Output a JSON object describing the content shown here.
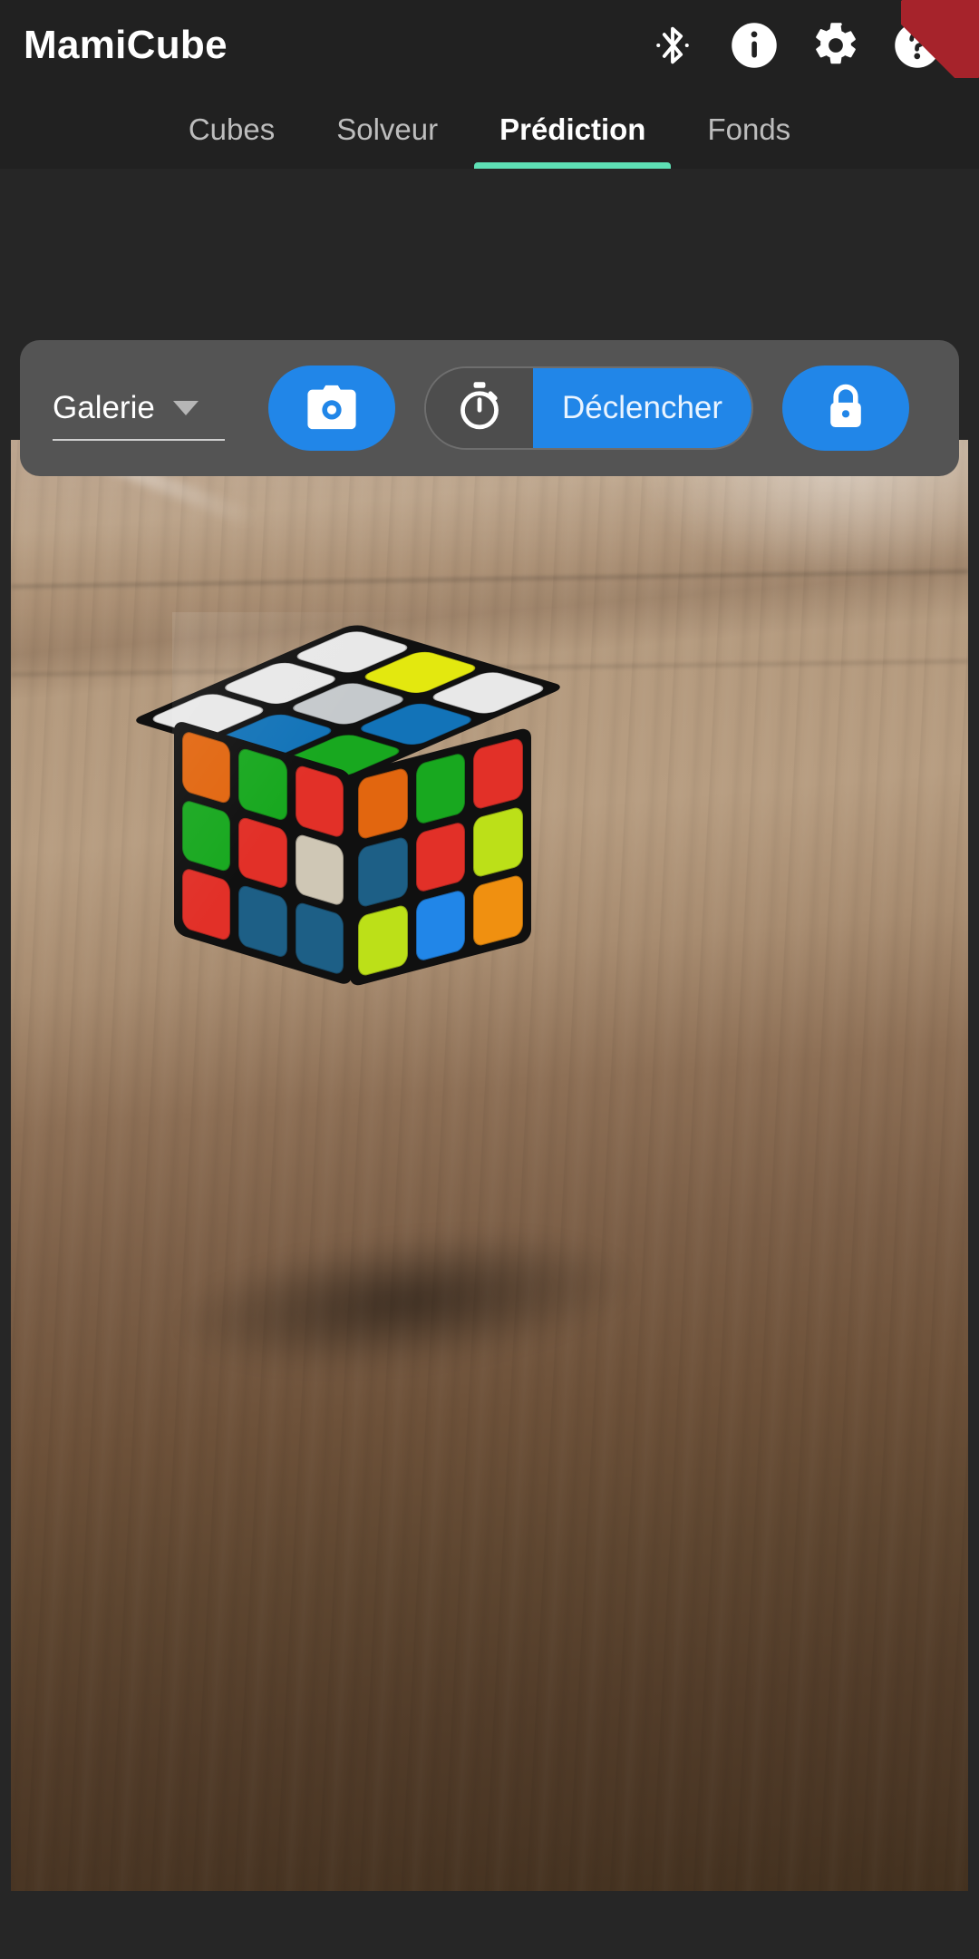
{
  "app": {
    "title": "MamiCube",
    "accent_blue": "#2186e8",
    "tab_indicator": "#5ee0b5",
    "appbar_bg": "#212121",
    "panel_bg": "#545454",
    "ribbon_color": "#a6232b"
  },
  "appbar": {
    "icons": [
      {
        "name": "bluetooth-icon",
        "label": "Bluetooth"
      },
      {
        "name": "info-icon",
        "label": "Informations"
      },
      {
        "name": "settings-gear-icon",
        "label": "Paramètres"
      },
      {
        "name": "help-icon",
        "label": "Aide"
      }
    ]
  },
  "tabs": [
    {
      "label": "Cubes",
      "active": false
    },
    {
      "label": "Solveur",
      "active": false
    },
    {
      "label": "Prédiction",
      "active": true
    },
    {
      "label": "Fonds",
      "active": false
    }
  ],
  "controls": {
    "source_select": {
      "value": "Galerie",
      "options": [
        "Galerie",
        "Caméra"
      ]
    },
    "camera_button": {
      "icon": "camera-icon"
    },
    "timer_icon": "stopwatch-icon",
    "trigger_button": {
      "label": "Déclencher"
    },
    "lock_button": {
      "icon": "lock-closed-icon"
    }
  },
  "preview": {
    "alt": "Photo d'un Rubik's Cube 3x3 posé sur une table en bois",
    "cube": {
      "type": "rubiks-cube-3x3",
      "faces": {
        "top": [
          [
            "#e8e8e8",
            "#e3e80f",
            "#e8e8e8"
          ],
          [
            "#e8e8e8",
            "#c5c9cc",
            "#1273b8"
          ],
          [
            "#e8e8e8",
            "#1273b8",
            "#18a81f"
          ]
        ],
        "left": [
          [
            "#e2660f",
            "#18a81f",
            "#e23028"
          ],
          [
            "#18a81f",
            "#e23028",
            "#cfc7b5"
          ],
          [
            "#e23028",
            "#1d5f86",
            "#1d5f86"
          ]
        ],
        "right": [
          [
            "#e2660f",
            "#18a81f",
            "#e23028"
          ],
          [
            "#1d5f86",
            "#e23028",
            "#bce018"
          ],
          [
            "#bce018",
            "#2186e8",
            "#f09010"
          ]
        ]
      }
    }
  }
}
